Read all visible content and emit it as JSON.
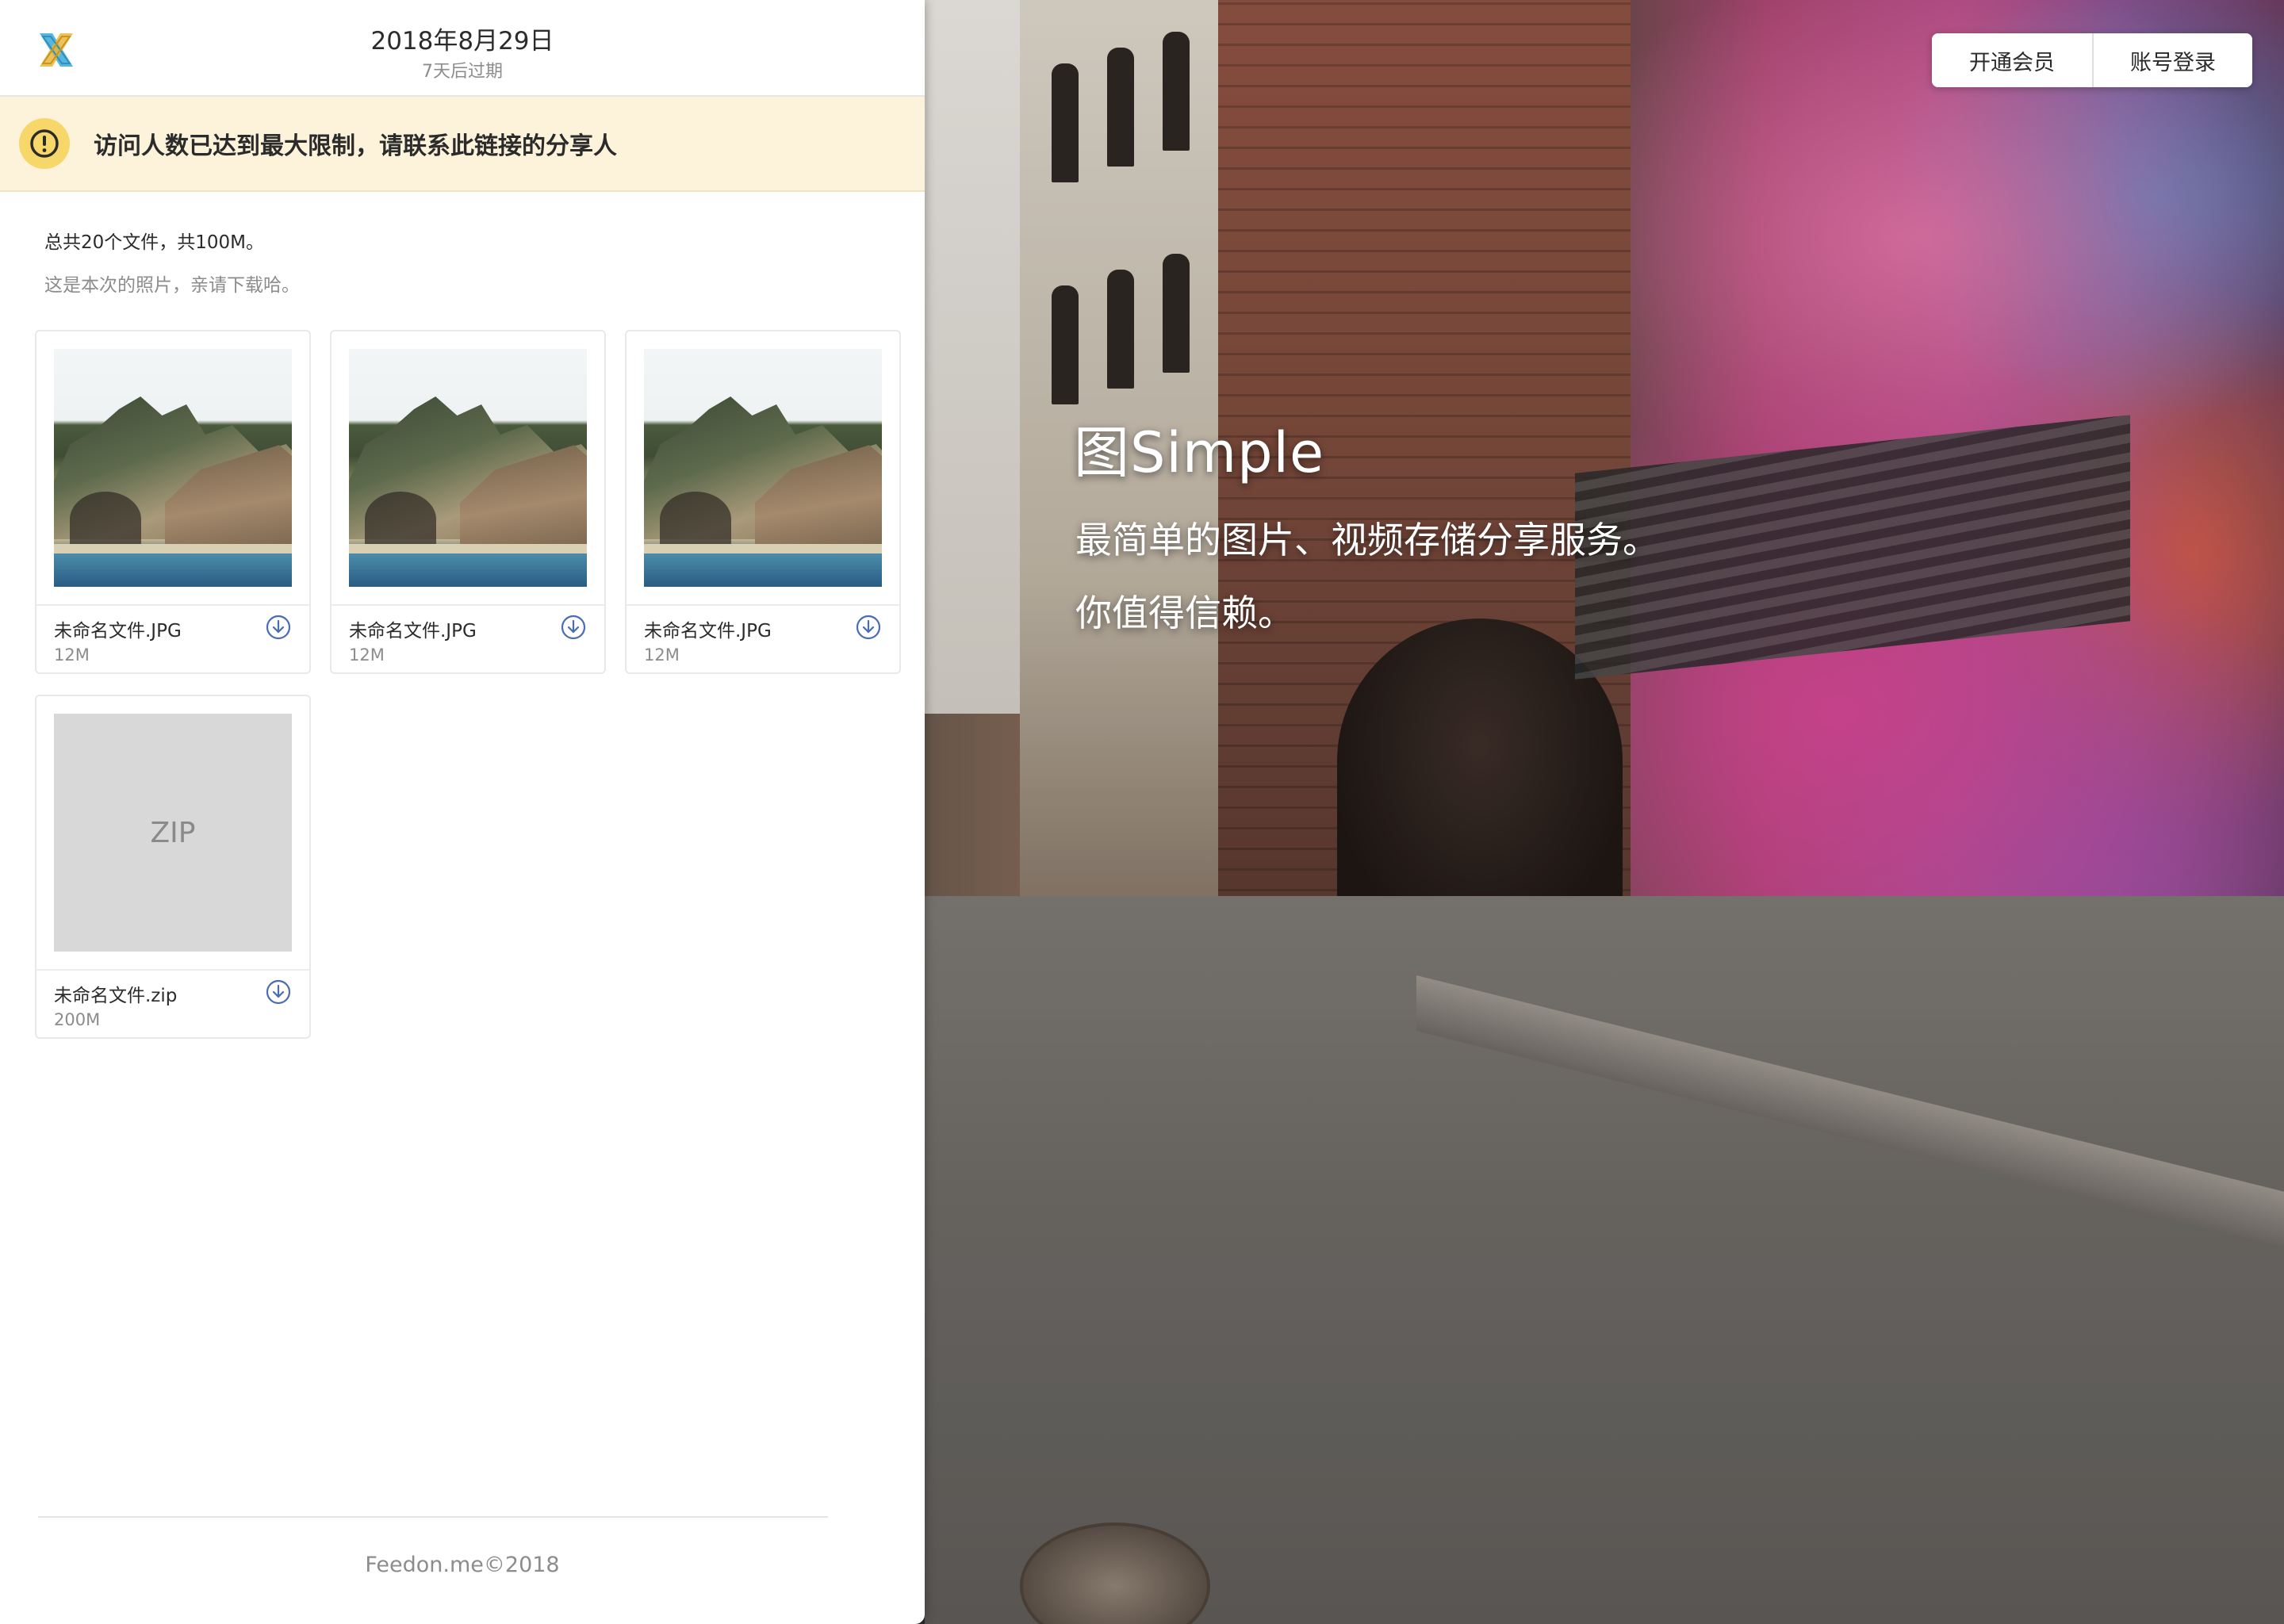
{
  "header": {
    "date": "2018年8月29日",
    "expire_note": "7天后过期",
    "logo_icon": "feedon-logo-icon"
  },
  "alert": {
    "icon": "exclamation-circle-icon",
    "message": "访问人数已达到最大限制，请联系此链接的分享人",
    "color": "#fdf3db"
  },
  "summary": {
    "total": "总共20个文件，共100M。",
    "description": "这是本次的照片，亲请下载哈。"
  },
  "files": [
    {
      "name": "未命名文件.JPG",
      "size": "12M",
      "thumb": "photo"
    },
    {
      "name": "未命名文件.JPG",
      "size": "12M",
      "thumb": "photo"
    },
    {
      "name": "未命名文件.JPG",
      "size": "12M",
      "thumb": "photo"
    },
    {
      "name": "未命名文件.zip",
      "size": "200M",
      "thumb": "zip",
      "thumb_label": "ZIP"
    }
  ],
  "download_icon": "download-circle-icon",
  "footer": {
    "copyright": "Feedon.me©2018"
  },
  "hero": {
    "title": "图Simple",
    "subtitle_line1": "最简单的图片、视频存储分享服务。",
    "subtitle_line2": "你值得信赖。"
  },
  "top_nav": {
    "membership_label": "开通会员",
    "login_label": "账号登录"
  },
  "colors": {
    "accent": "#4a6cb3",
    "alert_icon": "#f7d76a",
    "logo_blue": "#3aa8d8",
    "logo_gold": "#e8b63c"
  }
}
